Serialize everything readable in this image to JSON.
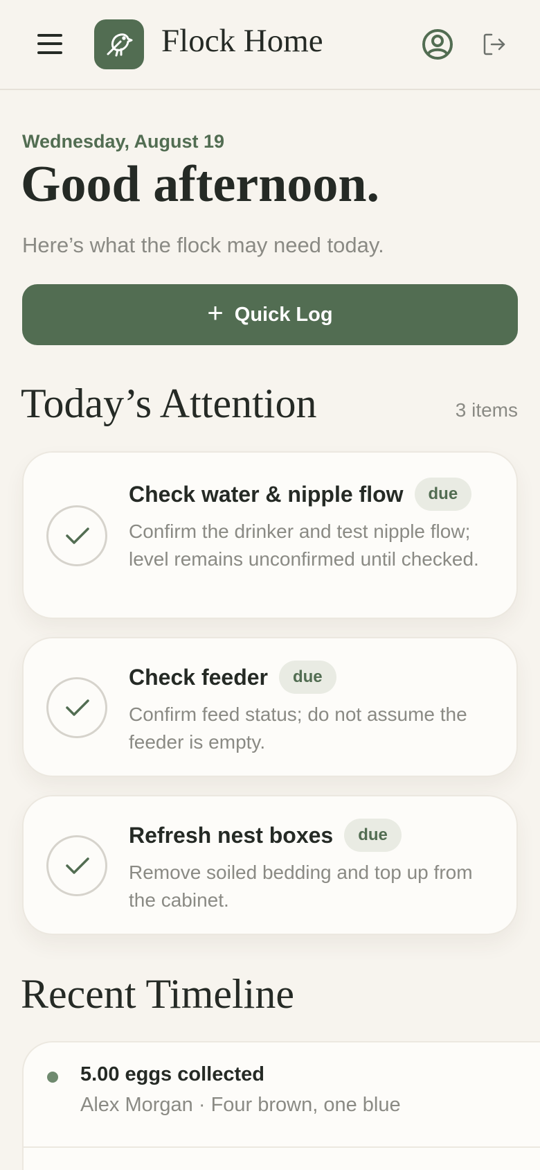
{
  "header": {
    "title": "Flock Home",
    "menu_icon": "hamburger-menu-icon",
    "logo_icon": "bird-icon",
    "account_icon": "user-circle-icon",
    "logout_icon": "logout-icon"
  },
  "greeting": {
    "date": "Wednesday, August 19",
    "headline": "Good afternoon.",
    "subtitle": "Here’s what the flock may need today."
  },
  "quick_log": {
    "label": "Quick Log",
    "icon": "plus-icon"
  },
  "attention": {
    "title": "Today’s Attention",
    "count": "3 items",
    "tasks": [
      {
        "title": "Check water & nipple flow",
        "badge": "due",
        "description": "Confirm the drinker and test nipple flow; level remains unconfirmed until checked."
      },
      {
        "title": "Check feeder",
        "badge": "due",
        "description": "Confirm feed status; do not assume the feeder is empty."
      },
      {
        "title": "Refresh nest boxes",
        "badge": "due",
        "description": "Remove soiled bedding and top up from the cabinet."
      }
    ]
  },
  "timeline": {
    "title": "Recent Timeline",
    "entries": [
      {
        "title": "5.00 eggs collected",
        "meta": "Alex Morgan · Four brown, one blue"
      }
    ]
  },
  "colors": {
    "accent": "#526d52",
    "background": "#f7f4ee",
    "card": "#fdfcf9",
    "muted_text": "#8a8a84",
    "badge_bg": "#e9ebe3"
  }
}
